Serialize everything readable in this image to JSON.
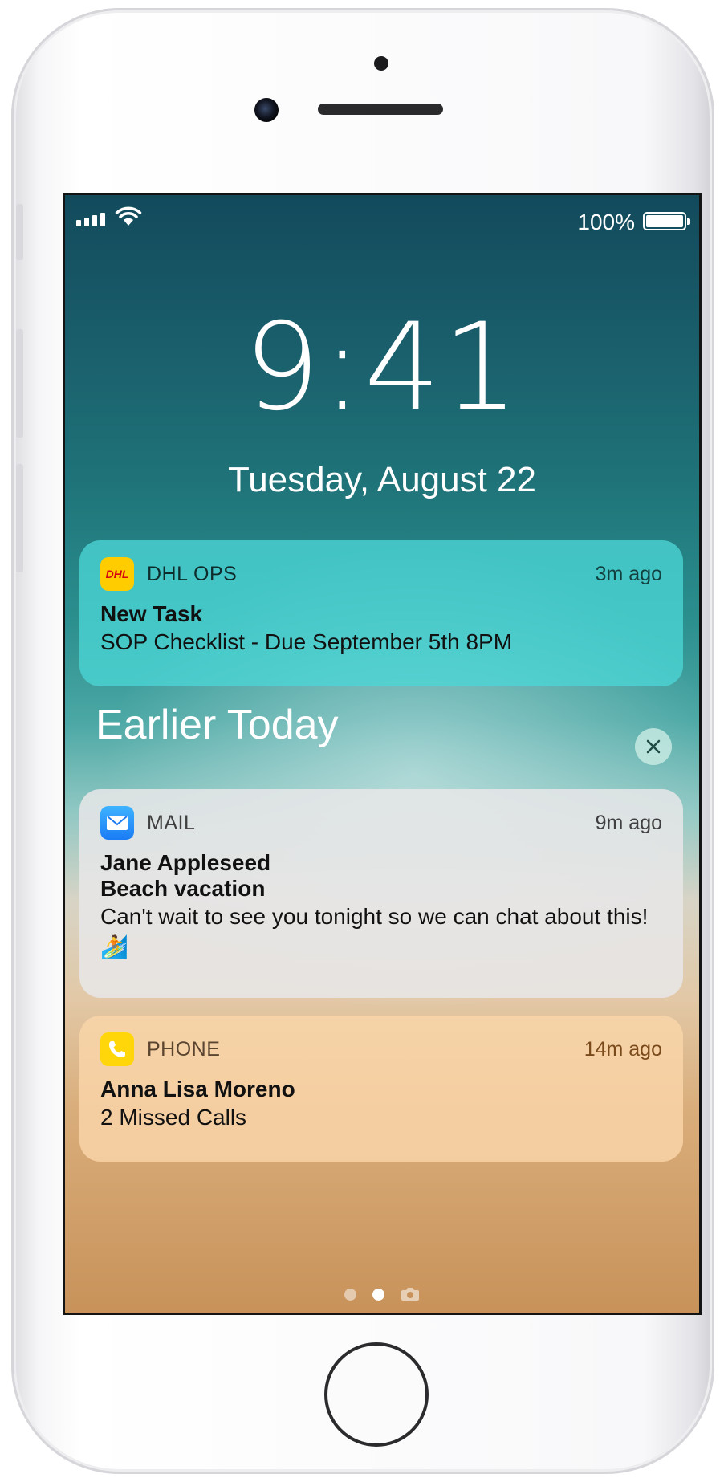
{
  "status_bar": {
    "battery_percent": "100%",
    "battery_level": 1.0,
    "signal_bars": 4
  },
  "lock_screen": {
    "time": "9:41",
    "date": "Tuesday, August 22"
  },
  "notifications": [
    {
      "app": "DHL OPS",
      "icon": "dhl-icon",
      "icon_text": "DHL",
      "time_ago": "3m ago",
      "title": "New Task",
      "body": "SOP Checklist - Due September 5th 8PM"
    }
  ],
  "earlier_section": {
    "heading": "Earlier Today",
    "clear_icon": "close-icon",
    "notifications": [
      {
        "app": "MAIL",
        "icon": "mail-icon",
        "time_ago": "9m ago",
        "sender": "Jane Appleseed",
        "subject": "Beach vacation",
        "body": "Can't wait to see you tonight so we can chat about this! 🏄"
      },
      {
        "app": "PHONE",
        "icon": "phone-icon",
        "time_ago": "14m ago",
        "title": "Anna Lisa Moreno",
        "body": "2 Missed Calls"
      }
    ]
  },
  "page_indicator": {
    "pages": 2,
    "active_page": 2,
    "camera_icon": "camera-icon"
  },
  "colors": {
    "dhl_yellow": "#ffcc00",
    "dhl_red": "#d40511",
    "mail_blue": "#1a7cf5",
    "phone_yellow": "#ffd60a"
  }
}
